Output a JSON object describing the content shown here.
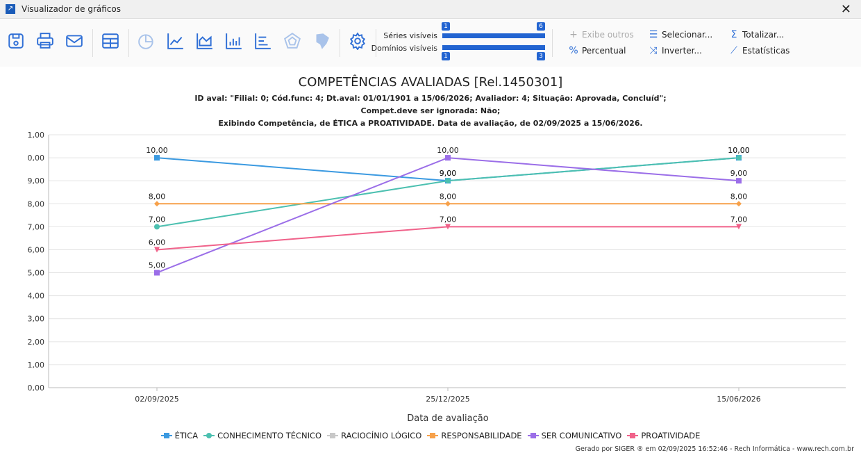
{
  "window": {
    "title": "Visualizador de gráficos",
    "close": "✕"
  },
  "toolbar": {
    "icons": [
      "save-icon",
      "print-icon",
      "email-icon",
      "table-icon",
      "pie-chart-icon",
      "line-chart-icon",
      "area-chart-icon",
      "bar-chart-icon",
      "horizontal-bar-icon",
      "radar-chart-icon",
      "map-icon",
      "settings-icon"
    ],
    "series_label": "Séries visíveis",
    "series_min": "1",
    "series_max": "6",
    "domains_label": "Domínios visíveis",
    "domains_min": "1",
    "domains_max": "3",
    "exibe_outros": "Exibe outros",
    "percentual": "Percentual",
    "selecionar": "Selecionar...",
    "inverter": "Inverter...",
    "totalizar": "Totalizar...",
    "estatisticas": "Estatísticas"
  },
  "chart_data": {
    "type": "line",
    "title": "COMPETÊNCIAS AVALIADAS [Rel.1450301]",
    "subtitles": [
      "ID aval: \"Filial: 0; Cód.func: 4; Dt.aval: 01/01/1901 a 15/06/2026; Avaliador: 4; Situação: Aprovada, Concluíd\";",
      "Compet.deve ser ignorada: Não;",
      "Exibindo Competência, de ÉTICA a PROATIVIDADE. Data de avaliação, de 02/09/2025 a 15/06/2026."
    ],
    "xlabel": "Data de avaliação",
    "categories": [
      "02/09/2025",
      "25/12/2025",
      "15/06/2026"
    ],
    "ylim": [
      0,
      11
    ],
    "yticks": [
      "0,00",
      "1,00",
      "2,00",
      "3,00",
      "4,00",
      "5,00",
      "6,00",
      "7,00",
      "8,00",
      "9,00",
      "0,00",
      "1,00"
    ],
    "series": [
      {
        "name": "ÉTICA",
        "color": "#3b9ae1",
        "marker": "square",
        "values": [
          10,
          9,
          10
        ]
      },
      {
        "name": "CONHECIMENTO TÉCNICO",
        "color": "#4cc0b0",
        "marker": "circle",
        "values": [
          7,
          9,
          10
        ]
      },
      {
        "name": "RACIOCÍNIO LÓGICO",
        "color": "#c8c8c8",
        "marker": "triangle",
        "values": [
          7,
          9,
          10
        ],
        "hidden": true
      },
      {
        "name": "RESPONSABILIDADE",
        "color": "#f7a14a",
        "marker": "diamond",
        "values": [
          8,
          8,
          8
        ]
      },
      {
        "name": "SER COMUNICATIVO",
        "color": "#9b6ee8",
        "marker": "square",
        "values": [
          5,
          10,
          9
        ]
      },
      {
        "name": "PROATIVIDADE",
        "color": "#f0628a",
        "marker": "triangle-down",
        "values": [
          6,
          7,
          7
        ]
      }
    ],
    "legend": "bottom"
  },
  "footer": "Gerado por SIGER ® em 02/09/2025 16:52:46 - Rech Informática - www.rech.com.br"
}
